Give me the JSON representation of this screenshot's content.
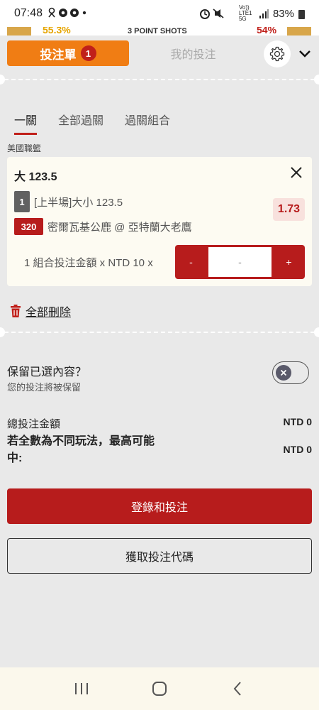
{
  "status_bar": {
    "time": "07:48",
    "notif_icons": [
      "link-icon",
      "chrome-icon",
      "chrome-icon",
      "dot-icon"
    ],
    "network": "Vo)) LTE1 5G",
    "battery": "83%"
  },
  "background_peek": {
    "left_pct": "55.3%",
    "center_text": "3 POINT SHOTS",
    "right_pct": "54%"
  },
  "header": {
    "bet_slip_label": "投注單",
    "bet_slip_count": "1",
    "my_bets_label": "我的投注"
  },
  "subtabs": [
    {
      "label": "一關",
      "active": true
    },
    {
      "label": "全部過關",
      "active": false
    },
    {
      "label": "過關組合",
      "active": false
    }
  ],
  "league": "美國職籃",
  "bet": {
    "title": "大 123.5",
    "selection_index": "1",
    "market": "[上半場]大小 123.5",
    "odds": "1.73",
    "event_id": "320",
    "event_name": "密爾瓦基公鹿 @ 亞特蘭大老鷹",
    "stake_label": "1 組合投注金額 x NTD 10 x",
    "stepper_minus": "-",
    "stepper_value": "-",
    "stepper_plus": "+"
  },
  "delete_all_label": "全部刪除",
  "keep": {
    "title": "保留已選內容？",
    "subtitle": "您的投注將被保留",
    "enabled": false
  },
  "totals": {
    "total_label": "總投注金額",
    "total_value": "NTD 0",
    "max_win_label": "若全數為不同玩法，最高可能中:",
    "max_win_value": "NTD 0"
  },
  "buttons": {
    "login_bet": "登錄和投注",
    "get_code": "獲取投注代碼"
  },
  "colors": {
    "accent_orange": "#f07d14",
    "brand_red": "#b71c1c",
    "sheet_bg": "#e9e9e9",
    "card_bg": "#fdfbf2"
  }
}
